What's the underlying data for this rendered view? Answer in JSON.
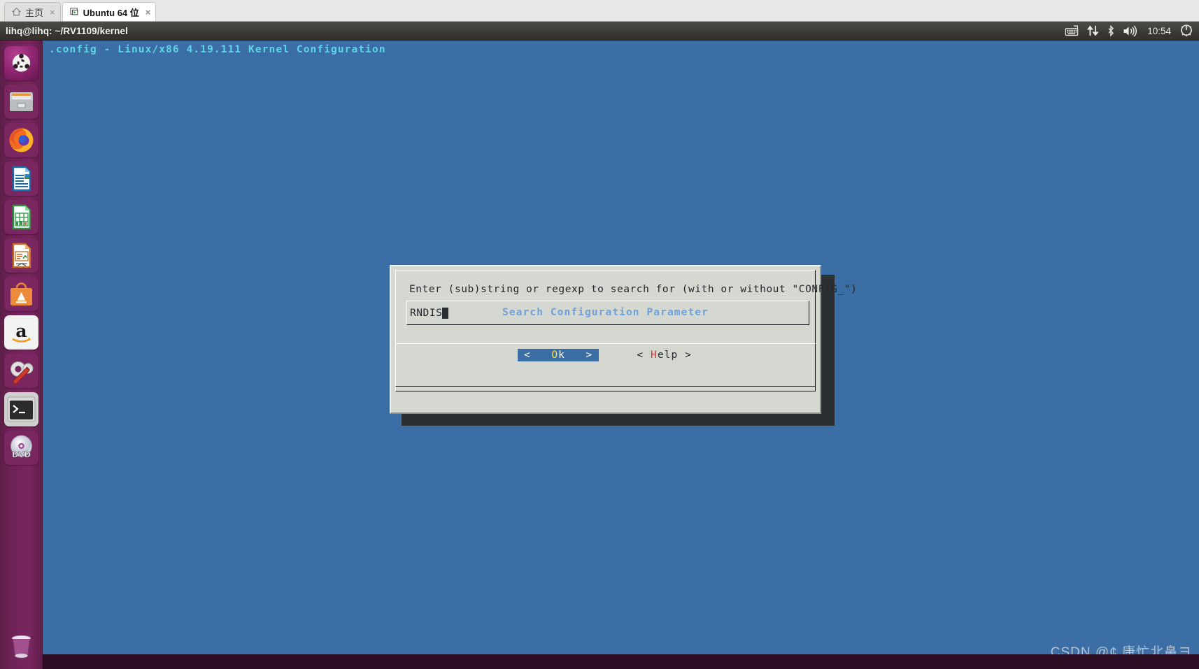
{
  "vmware": {
    "tabs": [
      {
        "label": "主页",
        "icon": "home-icon",
        "active": false,
        "close": "×"
      },
      {
        "label": "Ubuntu 64 位",
        "icon": "virtual-machine-icon",
        "active": true,
        "close": "×"
      }
    ]
  },
  "desktop": {
    "window_title": "lihq@lihq: ~/RV1109/kernel",
    "tray": {
      "icons": [
        "keyboard-icon",
        "network-updown-icon",
        "bluetooth-icon",
        "volume-icon"
      ],
      "clock": "10:54",
      "power_icon": "power-gear-icon"
    },
    "launcher": {
      "items": [
        {
          "name": "ubuntu-dash-home",
          "label": "Dash 主页"
        },
        {
          "name": "files",
          "label": "文件"
        },
        {
          "name": "firefox",
          "label": "Firefox"
        },
        {
          "name": "libreoffice-writer",
          "label": "LibreOffice Writer"
        },
        {
          "name": "libreoffice-calc",
          "label": "LibreOffice Calc"
        },
        {
          "name": "libreoffice-impress",
          "label": "LibreOffice Impress"
        },
        {
          "name": "ubuntu-software",
          "label": "Ubuntu 软件"
        },
        {
          "name": "amazon",
          "label": "Amazon"
        },
        {
          "name": "system-settings",
          "label": "系统设置"
        },
        {
          "name": "terminal",
          "label": "终端",
          "running": true
        },
        {
          "name": "dvd-media",
          "label": "DVD"
        }
      ],
      "trash": {
        "name": "trash",
        "label": "回收站"
      }
    },
    "watermark": "CSDN @¢ 康忙北鼻ヨ"
  },
  "menuconfig": {
    "title": ".config - Linux/x86 4.19.111 Kernel Configuration",
    "dialog": {
      "title": "Search Configuration Parameter",
      "prompt": "Enter (sub)string or regexp to search for (with or without \"CONFIG_\")",
      "input_value": "RNDIS",
      "buttons": [
        {
          "name": "ok",
          "prefix": "<   ",
          "hotkey": "O",
          "rest": "k",
          "suffix": "   >",
          "selected": true
        },
        {
          "name": "help",
          "prefix": "< ",
          "hotkey": "H",
          "rest": "elp",
          "suffix": " >",
          "selected": false
        }
      ]
    }
  },
  "colors": {
    "terminal_blue": "#3a6ea5",
    "dialog_bg": "#d4d8d0",
    "title_cyan": "#5fd3e8",
    "dialog_title_blue": "#6fa0d8",
    "hotkey_yellow": "#f2e24a",
    "hotkey_red": "#c4343c",
    "launcher_purple": "#6e2256"
  }
}
